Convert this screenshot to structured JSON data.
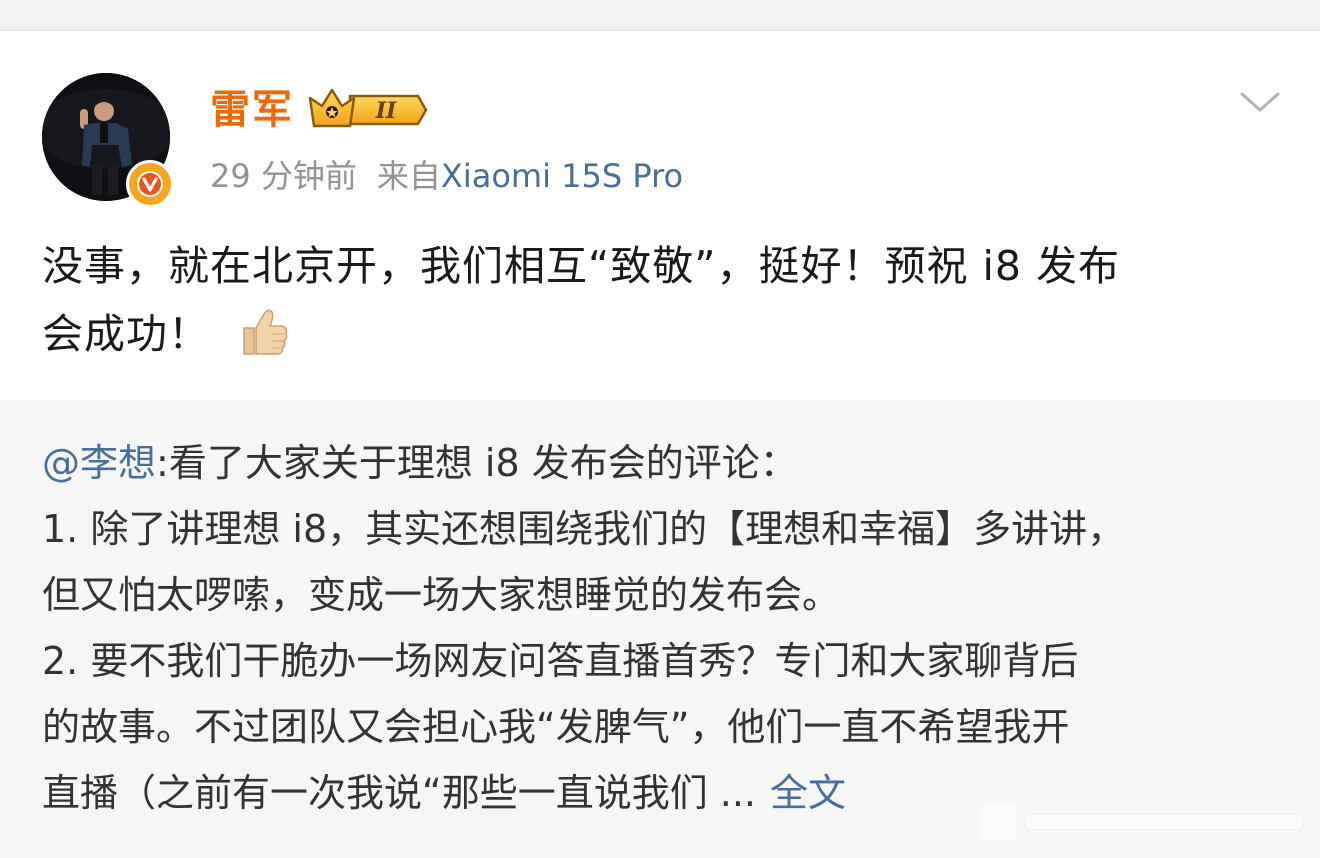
{
  "author": {
    "name": "雷军",
    "level_badge": "II",
    "verified_icon": "verified-v-icon",
    "avatar_icon": "avatar-photo"
  },
  "meta": {
    "time": "29 分钟前",
    "source_prefix": "来自",
    "source_device": "Xiaomi 15S Pro"
  },
  "post": {
    "line1": "没事，就在北京开，我们相互“致敬”，挺好！预祝 i8 发布",
    "line2": "会成功！",
    "emoji": "thumbs-up-icon"
  },
  "repost": {
    "mention": "@李想",
    "intro": ":看了大家关于理想 i8 发布会的评论：",
    "line2": "1. 除了讲理想 i8，其实还想围绕我们的【理想和幸福】多讲讲，",
    "line3": "但又怕太啰嗦，变成一场大家想睡觉的发布会。",
    "line4": "2. 要不我们干脆办一场网友问答直播首秀？专门和大家聊背后",
    "line5": "的故事。不过团队又会担心我“发脾气”，他们一直不希望我开",
    "line6": "直播（之前有一次我说“那些一直说我们 ...",
    "full_link": "全文"
  },
  "colors": {
    "username": "#e86b0f",
    "link": "#4a6e9b",
    "meta": "#939393",
    "repost_bg": "#f6f6f6",
    "verified_badge": "#f5a623"
  }
}
